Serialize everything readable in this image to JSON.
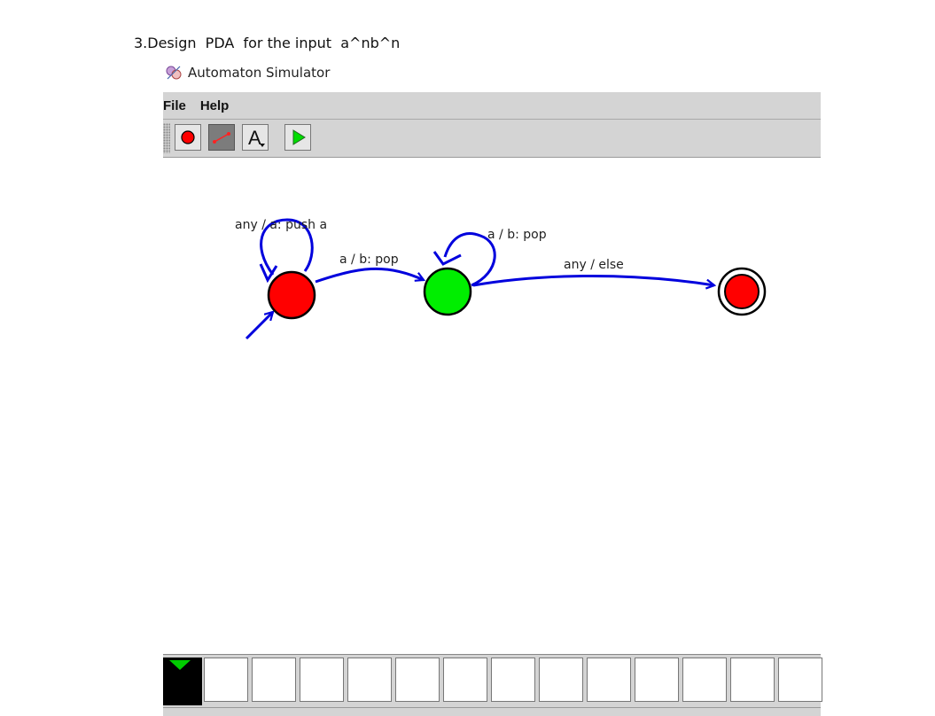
{
  "document": {
    "heading": "3.Design  PDA  for the input  a^nb^n"
  },
  "window": {
    "title": "Automaton Simulator",
    "icon": "automaton-app-icon"
  },
  "menu": {
    "items": [
      "File",
      "Help"
    ]
  },
  "toolbar": {
    "tools": [
      {
        "name": "state-tool",
        "icon": "red-circle-icon",
        "pressed": false
      },
      {
        "name": "transition-tool",
        "icon": "transition-line-icon",
        "pressed": true
      },
      {
        "name": "label-tool",
        "icon": "text-a-icon",
        "label": "A",
        "pressed": false
      },
      {
        "name": "run-tool",
        "icon": "play-icon",
        "pressed": false
      }
    ]
  },
  "automaton": {
    "states": [
      {
        "id": "q0",
        "role": "start",
        "color": "#ff0000",
        "accepting": false
      },
      {
        "id": "q1",
        "role": "middle",
        "color": "#00ee00",
        "accepting": false
      },
      {
        "id": "q2",
        "role": "final",
        "color": "#ff0000",
        "accepting": true
      }
    ],
    "transitions": [
      {
        "from": "q0",
        "to": "q0",
        "label": "any / a: push a"
      },
      {
        "from": "q0",
        "to": "q1",
        "label": "a / b: pop"
      },
      {
        "from": "q1",
        "to": "q1",
        "label": "a / b: pop"
      },
      {
        "from": "q1",
        "to": "q2",
        "label": "any / else"
      }
    ],
    "edge_color": "#0000dd"
  },
  "tape": {
    "cell_count": 13,
    "head_color": "#00cc00"
  }
}
